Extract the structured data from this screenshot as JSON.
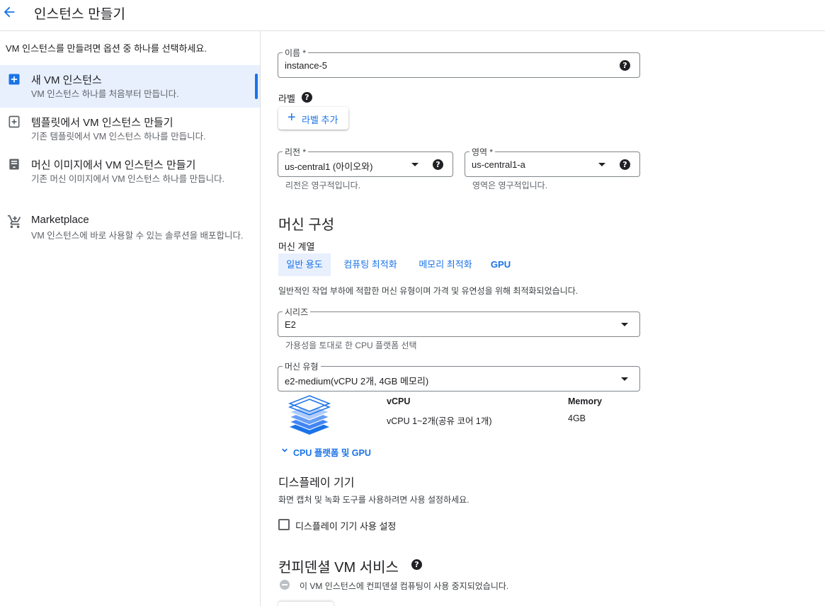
{
  "header": {
    "title": "인스턴스 만들기"
  },
  "sidebar": {
    "intro": "VM 인스턴스를 만들려면 옵션 중 하나를 선택하세요.",
    "items": [
      {
        "title": "새 VM 인스턴스",
        "desc": "VM 인스턴스 하나를 처음부터 만듭니다.",
        "icon": "add-box-icon",
        "active": true
      },
      {
        "title": "템플릿에서 VM 인스턴스 만들기",
        "desc": "기존 템플릿에서 VM 인스턴스 하나를 만듭니다.",
        "icon": "template-add-icon",
        "active": false
      },
      {
        "title": "머신 이미지에서 VM 인스턴스 만들기",
        "desc": "기존 머신 이미지에서 VM 인스턴스 하나를 만듭니다.",
        "icon": "machine-image-icon",
        "active": false
      },
      {
        "title": "Marketplace",
        "desc": "VM 인스턴스에 바로 사용할 수 있는 솔루션을 배포합니다.",
        "icon": "cart-icon",
        "active": false
      }
    ]
  },
  "form": {
    "name": {
      "label": "이름 *",
      "value": "instance-5"
    },
    "labels": {
      "heading": "라벨",
      "add_button": "라벨 추가"
    },
    "region": {
      "label": "리전 *",
      "value": "us-central1 (아이오와)",
      "hint": "리전은 영구적입니다."
    },
    "zone": {
      "label": "영역 *",
      "value": "us-central1-a",
      "hint": "영역은 영구적입니다."
    },
    "machine_config": {
      "heading": "머신 구성",
      "family_label": "머신 계열",
      "tabs": [
        "일반 용도",
        "컴퓨팅 최적화",
        "메모리 최적화",
        "GPU"
      ],
      "active_tab": "일반 용도",
      "description": "일반적인 작업 부하에 적합한 머신 유형이며 가격 및 유연성을 위해 최적화되었습니다.",
      "series": {
        "label": "시리즈",
        "value": "E2",
        "hint": "가용성을 토대로 한 CPU 플랫폼 선택"
      },
      "machine_type": {
        "label": "머신 유형",
        "value": "e2-medium(vCPU 2개, 4GB 메모리)"
      },
      "specs": {
        "vcpu_header": "vCPU",
        "memory_header": "Memory",
        "vcpu_value": "vCPU 1~2개(공유 코어 1개)",
        "memory_value": "4GB"
      },
      "expand_link": "CPU 플랫폼 및 GPU"
    },
    "display": {
      "heading": "디스플레이 기기",
      "description": "화면 캡처 및 녹화 도구를 사용하려면 사용 설정하세요.",
      "checkbox_label": "디스플레이 기기 사용 설정",
      "checked": false
    },
    "confidential": {
      "heading": "컨피덴셜 VM 서비스",
      "notice": "이 VM 인스턴스에 컨피덴셜 컴퓨팅이 사용 중지되었습니다."
    }
  },
  "colors": {
    "accent": "#1a73e8",
    "active_bg": "#e8f0fe",
    "text": "#202124",
    "muted": "#5f6368",
    "border": "#80868b"
  }
}
